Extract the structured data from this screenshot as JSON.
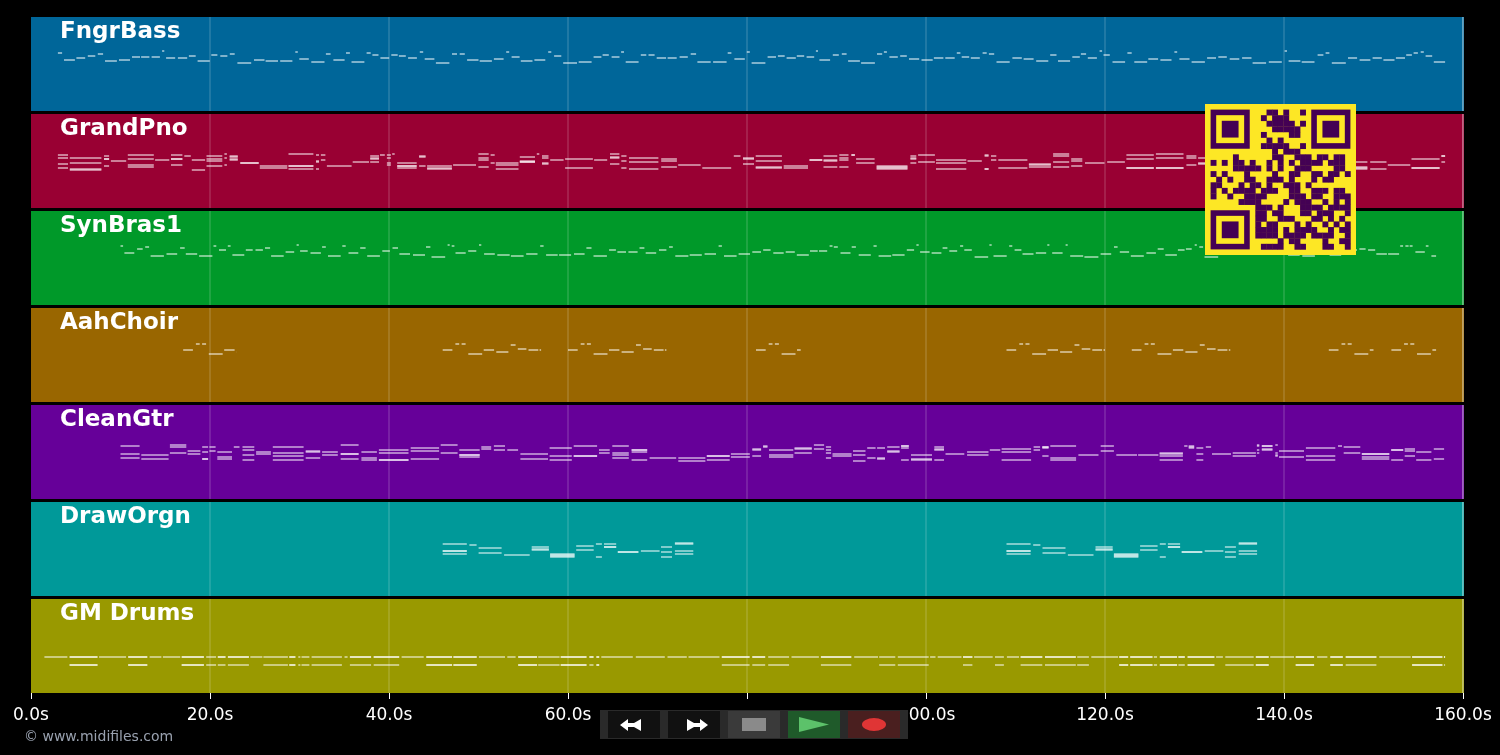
{
  "tracks": [
    {
      "name": "FngrBass",
      "color": "#006699"
    },
    {
      "name": "GrandPno",
      "color": "#990033"
    },
    {
      "name": "SynBras1",
      "color": "#009929"
    },
    {
      "name": "AahChoir",
      "color": "#996600"
    },
    {
      "name": "CleanGtr",
      "color": "#660099"
    },
    {
      "name": "DrawOrgn",
      "color": "#009999"
    },
    {
      "name": "GM Drums",
      "color": "#999900"
    }
  ],
  "time_axis": {
    "tick_labels": [
      "0.0s",
      "20.0s",
      "40.0s",
      "60.0s",
      "00.0s",
      "120.0s",
      "140.0s",
      "160.0s"
    ]
  },
  "transport": [
    {
      "kind": "rewind"
    },
    {
      "kind": "fast_forward"
    },
    {
      "kind": "stop"
    },
    {
      "kind": "play"
    },
    {
      "kind": "record"
    }
  ],
  "credit": "© www.midifiles.com"
}
